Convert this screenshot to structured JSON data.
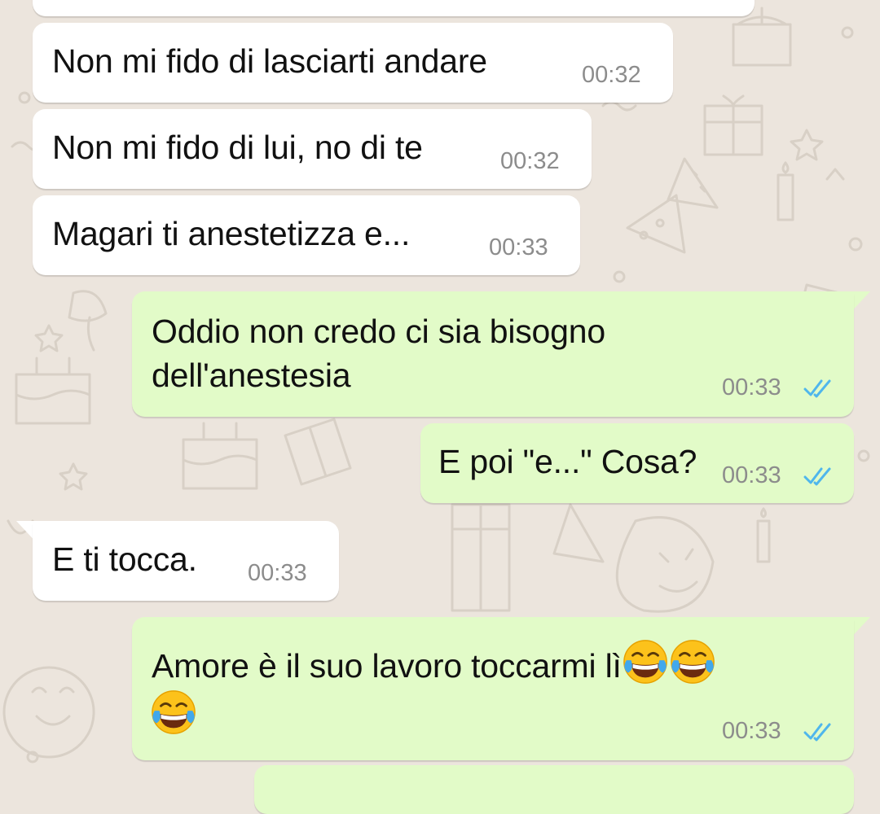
{
  "chat": {
    "messages": [
      {
        "direction": "in",
        "text": "Non mi fido di lasciarti andare",
        "time": "00:32"
      },
      {
        "direction": "in",
        "text": "Non mi fido di lui, no di te",
        "time": "00:32"
      },
      {
        "direction": "in",
        "text": "Magari ti anestetizza e...",
        "time": "00:33"
      },
      {
        "direction": "out",
        "text_line1": "Oddio non credo ci sia bisogno",
        "text_line2": "dell'anestesia",
        "time": "00:33",
        "status": "read"
      },
      {
        "direction": "out",
        "text": "E poi \"e...\" Cosa?",
        "time": "00:33",
        "status": "read"
      },
      {
        "direction": "in",
        "text": "E ti tocca.",
        "time": "00:33"
      },
      {
        "direction": "out",
        "text": "Amore è il suo lavoro toccarmi lì",
        "emoji": [
          "face-with-tears-of-joy",
          "face-with-tears-of-joy",
          "face-with-tears-of-joy"
        ],
        "time": "00:33",
        "status": "read"
      }
    ]
  },
  "colors": {
    "wallpaper": "#ece5dd",
    "incoming_bubble": "#ffffff",
    "outgoing_bubble": "#e2fbc8",
    "read_ticks": "#4fb6ec",
    "timestamp": "#8c8c8c"
  }
}
